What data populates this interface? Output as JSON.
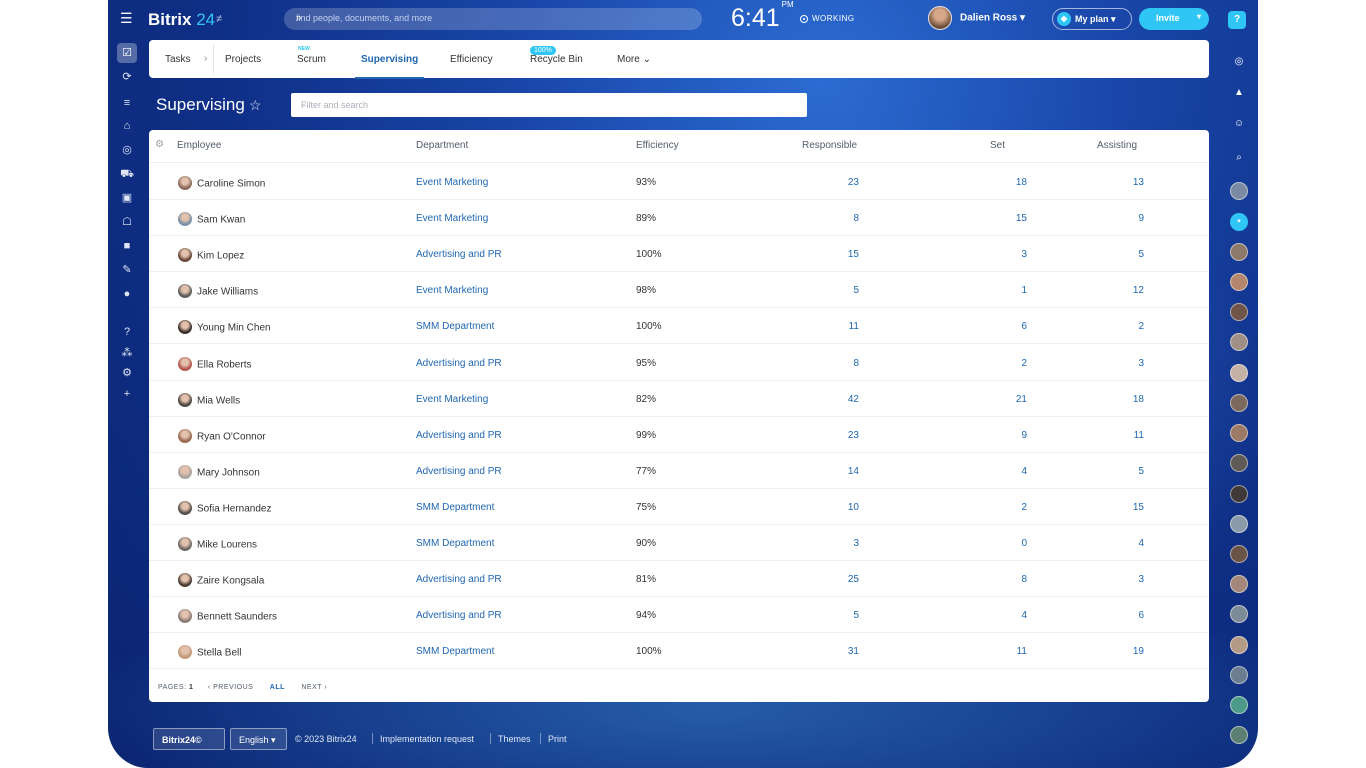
{
  "app": {
    "logo_main": "Bitrix",
    "logo_num": "24",
    "logo_sub": "≠"
  },
  "topbar": {
    "search_placeholder": "find people, documents, and more",
    "time": "6:41",
    "time_suffix": "PM",
    "status": "WORKING",
    "user_name": "Dalien Ross",
    "myplan_label": "My plan",
    "invite_label": "Invite",
    "help_label": "?"
  },
  "nav": {
    "tabs": [
      "Tasks",
      "Projects",
      "Scrum",
      "Supervising",
      "Efficiency",
      "Recycle Bin",
      "More"
    ],
    "scrum_badge": "NEW",
    "efficiency_badge": "100%",
    "active_tab": "Supervising"
  },
  "page": {
    "title": "Supervising",
    "filter_placeholder": "Filter and search"
  },
  "grid": {
    "columns": [
      "Employee",
      "Department",
      "Efficiency",
      "Responsible",
      "Set",
      "Assisting"
    ],
    "rows": [
      {
        "employee": "Caroline Simon",
        "department": "Event Marketing",
        "efficiency": "93%",
        "responsible": "23",
        "set": "18",
        "assisting": "13"
      },
      {
        "employee": "Sam Kwan",
        "department": "Event Marketing",
        "efficiency": "89%",
        "responsible": "8",
        "set": "15",
        "assisting": "9"
      },
      {
        "employee": "Kim Lopez",
        "department": "Advertising and PR",
        "efficiency": "100%",
        "responsible": "15",
        "set": "3",
        "assisting": "5"
      },
      {
        "employee": "Jake Williams",
        "department": "Event Marketing",
        "efficiency": "98%",
        "responsible": "5",
        "set": "1",
        "assisting": "12"
      },
      {
        "employee": "Young Min Chen",
        "department": "SMM Department",
        "efficiency": "100%",
        "responsible": "11",
        "set": "6",
        "assisting": "2"
      },
      {
        "employee": "Ella Roberts",
        "department": "Advertising and PR",
        "efficiency": "95%",
        "responsible": "8",
        "set": "2",
        "assisting": "3"
      },
      {
        "employee": "Mia Wells",
        "department": "Event Marketing",
        "efficiency": "82%",
        "responsible": "42",
        "set": "21",
        "assisting": "18"
      },
      {
        "employee": "Ryan O'Connor",
        "department": "Advertising and PR",
        "efficiency": "99%",
        "responsible": "23",
        "set": "9",
        "assisting": "11"
      },
      {
        "employee": "Mary Johnson",
        "department": "Advertising and PR",
        "efficiency": "77%",
        "responsible": "14",
        "set": "4",
        "assisting": "5"
      },
      {
        "employee": "Sofia Hernandez",
        "department": "SMM Department",
        "efficiency": "75%",
        "responsible": "10",
        "set": "2",
        "assisting": "15"
      },
      {
        "employee": "Mike Lourens",
        "department": "SMM Department",
        "efficiency": "90%",
        "responsible": "3",
        "set": "0",
        "assisting": "4"
      },
      {
        "employee": "Zaire Kongsala",
        "department": "Advertising and PR",
        "efficiency": "81%",
        "responsible": "25",
        "set": "8",
        "assisting": "3"
      },
      {
        "employee": "Bennett Saunders",
        "department": "Advertising and PR",
        "efficiency": "94%",
        "responsible": "5",
        "set": "4",
        "assisting": "6"
      },
      {
        "employee": "Stella Bell",
        "department": "SMM Department",
        "efficiency": "100%",
        "responsible": "31",
        "set": "11",
        "assisting": "19"
      }
    ],
    "pager": {
      "pages_label": "PAGES:",
      "page": "1",
      "previous": "PREVIOUS",
      "all": "ALL",
      "next": "NEXT"
    }
  },
  "footer": {
    "logo": "Bitrix24©",
    "language": "English",
    "copyright": "© 2023 Bitrix24",
    "links": [
      "Implementation request",
      "Themes",
      "Print"
    ]
  },
  "colors": {
    "accent": "#2fc6f6",
    "link": "#2067b0",
    "background": "#0f2f86"
  }
}
